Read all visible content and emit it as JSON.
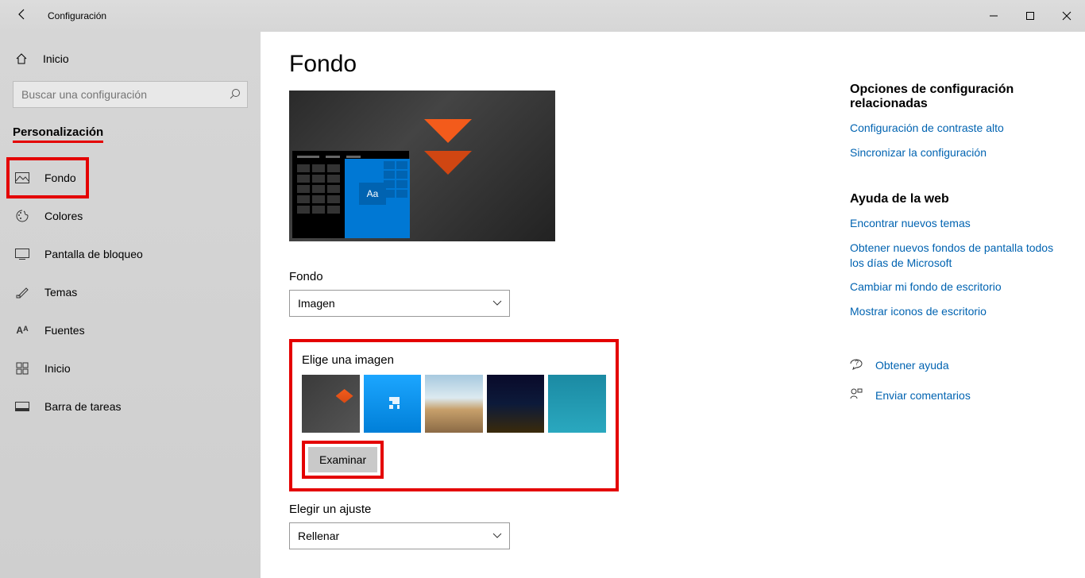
{
  "window": {
    "title": "Configuración"
  },
  "sidebar": {
    "home": "Inicio",
    "search_placeholder": "Buscar una configuración",
    "section": "Personalización",
    "items": [
      {
        "label": "Fondo",
        "icon": "picture-icon",
        "highlighted": true
      },
      {
        "label": "Colores",
        "icon": "palette-icon",
        "highlighted": false
      },
      {
        "label": "Pantalla de bloqueo",
        "icon": "lock-screen-icon",
        "highlighted": false
      },
      {
        "label": "Temas",
        "icon": "brush-icon",
        "highlighted": false
      },
      {
        "label": "Fuentes",
        "icon": "fonts-icon",
        "highlighted": false
      },
      {
        "label": "Inicio",
        "icon": "start-icon",
        "highlighted": false
      },
      {
        "label": "Barra de tareas",
        "icon": "taskbar-icon",
        "highlighted": false
      }
    ]
  },
  "page": {
    "heading": "Fondo",
    "preview_sample": "Aa",
    "background_label": "Fondo",
    "background_value": "Imagen",
    "choose_image_label": "Elige una imagen",
    "browse_label": "Examinar",
    "fit_label": "Elegir un ajuste",
    "fit_value": "Rellenar"
  },
  "related": {
    "heading": "Opciones de configuración relacionadas",
    "links": [
      "Configuración de contraste alto",
      "Sincronizar la configuración"
    ]
  },
  "webhelp": {
    "heading": "Ayuda de la web",
    "links": [
      "Encontrar nuevos temas",
      "Obtener nuevos fondos de pantalla todos los días de Microsoft",
      "Cambiar mi fondo de escritorio",
      "Mostrar iconos de escritorio"
    ]
  },
  "footer": {
    "help": "Obtener ayuda",
    "feedback": "Enviar comentarios"
  }
}
